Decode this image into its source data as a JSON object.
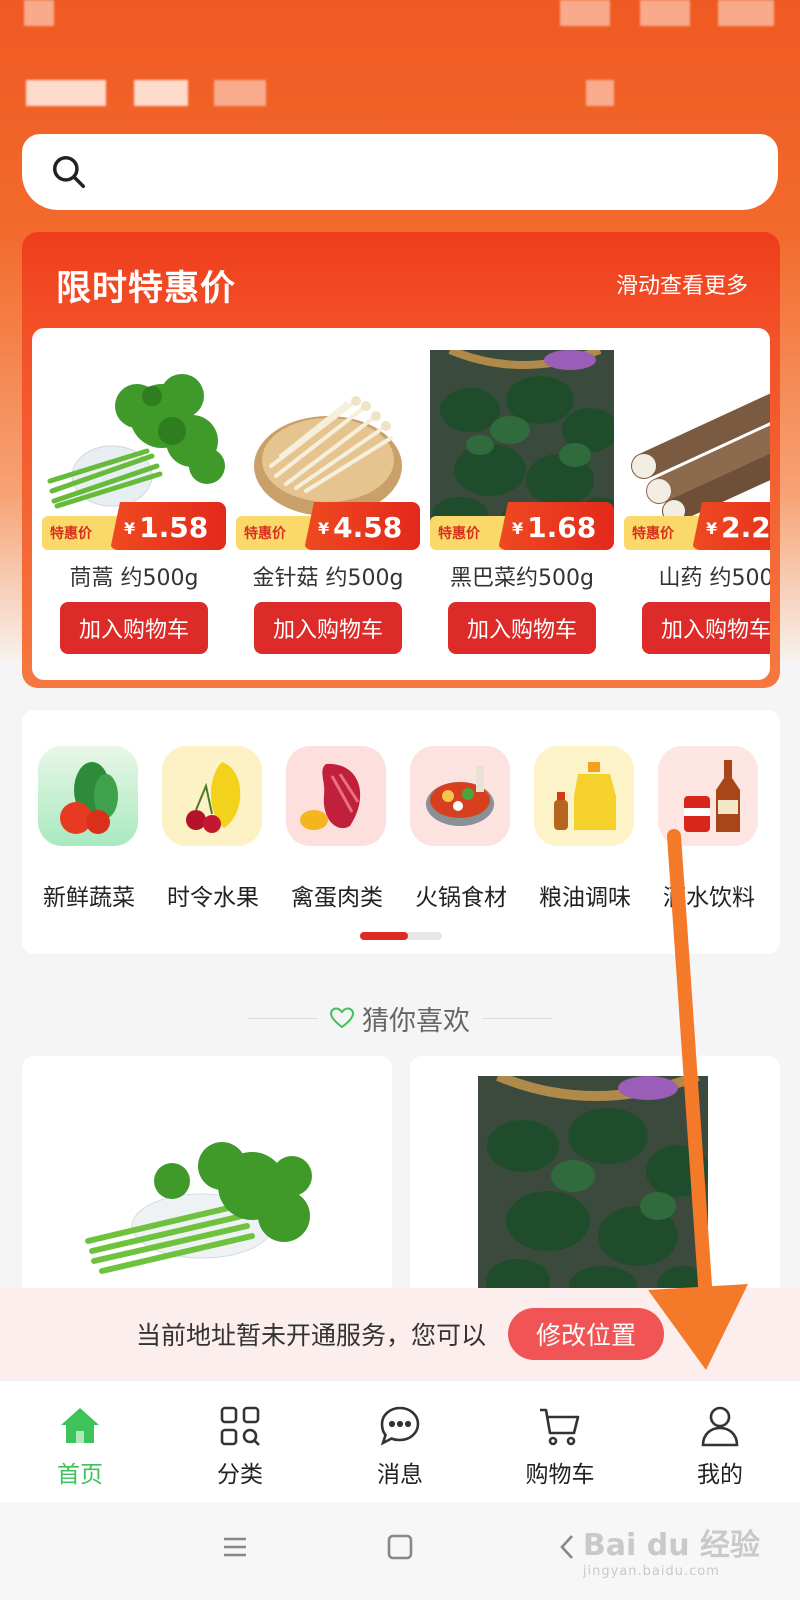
{
  "search": {
    "placeholder": ""
  },
  "flash_sale": {
    "title": "限时特惠价",
    "more": "滑动查看更多",
    "products": [
      {
        "tag": "特惠价",
        "currency": "¥",
        "price": "1.58",
        "name": "茼蒿 约500g",
        "button": "加入购物车"
      },
      {
        "tag": "特惠价",
        "currency": "¥",
        "price": "4.58",
        "name": "金针菇 约500g",
        "button": "加入购物车"
      },
      {
        "tag": "特惠价",
        "currency": "¥",
        "price": "1.68",
        "name": "黑巴菜约500g",
        "button": "加入购物车"
      },
      {
        "tag": "特惠价",
        "currency": "¥",
        "price": "2.2",
        "name": "山药 约500",
        "button": "加入购物车"
      }
    ]
  },
  "categories": [
    {
      "label": "新鲜蔬菜",
      "icon": "vegetable-icon"
    },
    {
      "label": "时令水果",
      "icon": "fruit-icon"
    },
    {
      "label": "禽蛋肉类",
      "icon": "meat-icon"
    },
    {
      "label": "火锅食材",
      "icon": "hotpot-icon"
    },
    {
      "label": "粮油调味",
      "icon": "oil-icon"
    },
    {
      "label": "酒水饮料",
      "icon": "drinks-icon"
    }
  ],
  "guess": {
    "title": "猜你喜欢"
  },
  "notice": {
    "text": "当前地址暂未开通服务，您可以",
    "button": "修改位置"
  },
  "tabs": [
    {
      "label": "首页",
      "icon": "home-icon",
      "active": true
    },
    {
      "label": "分类",
      "icon": "category-icon",
      "active": false
    },
    {
      "label": "消息",
      "icon": "message-icon",
      "active": false
    },
    {
      "label": "购物车",
      "icon": "cart-icon",
      "active": false
    },
    {
      "label": "我的",
      "icon": "profile-icon",
      "active": false
    }
  ],
  "watermark": {
    "main": "Bai du 经验",
    "sub": "jingyan.baidu.com"
  },
  "colors": {
    "accent": "#dc2b28",
    "active_tab": "#3fc25a",
    "header": "#ef5a22",
    "arrow": "#f47a2a"
  }
}
